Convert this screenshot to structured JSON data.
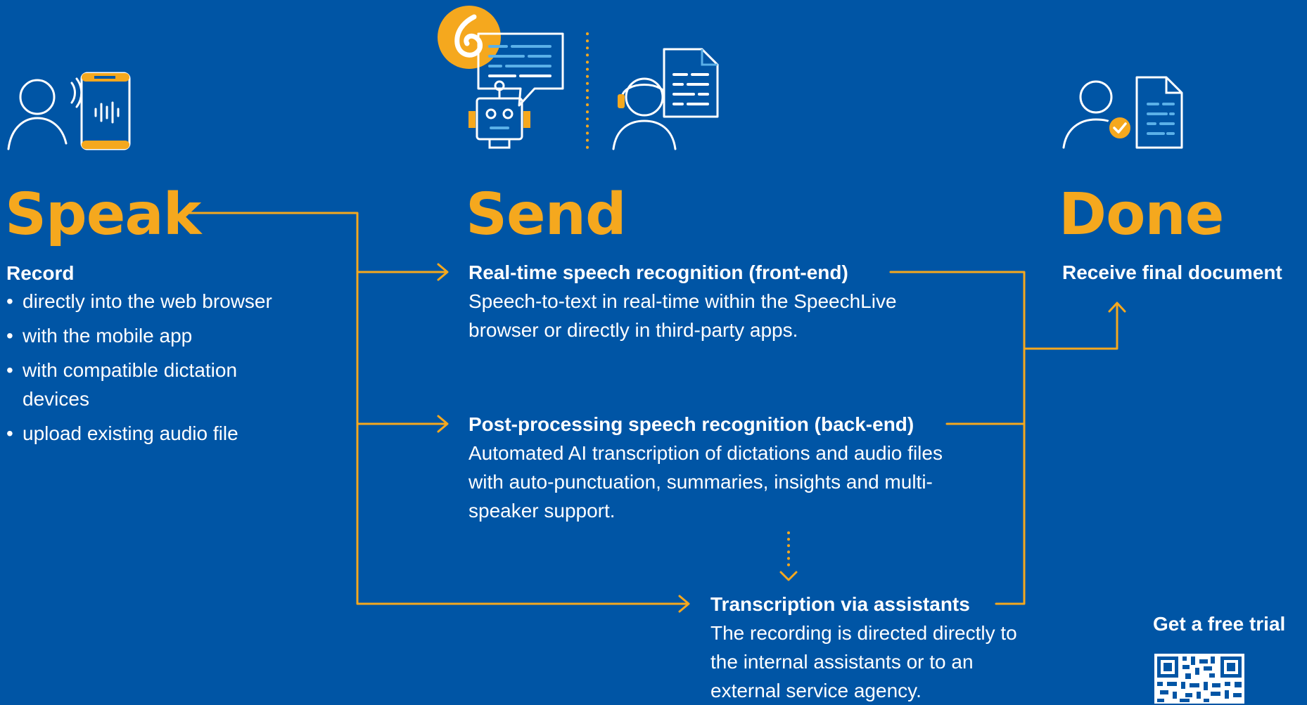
{
  "colors": {
    "background": "#0055a5",
    "accent": "#f5a81e",
    "text": "#ffffff",
    "light_blue": "#5ab0e8"
  },
  "speak": {
    "heading": "Speak",
    "subheading": "Record",
    "items": [
      "directly into the web browser",
      "with the mobile app",
      "with compatible dictation devices",
      "upload existing audio file"
    ]
  },
  "send": {
    "heading": "Send",
    "steps": [
      {
        "title": "Real-time speech recognition (front-end)",
        "body": "Speech-to-text in real-time within the SpeechLive browser or directly in third-party apps."
      },
      {
        "title": "Post-processing speech recognition (back-end)",
        "body": "Automated AI transcription of dictations and audio files with auto-punctuation, summaries, insights and multi-speaker support."
      },
      {
        "title": "Transcription via assistants",
        "body": "The recording is directed directly to the internal assistants or to an external service agency."
      }
    ]
  },
  "done": {
    "heading": "Done",
    "subheading": "Receive final document"
  },
  "trial": {
    "label": "Get a free trial"
  },
  "icons": [
    "person-phone-icon",
    "dragon-logo-icon",
    "chat-bubble-icon",
    "robot-icon",
    "person-headset-icon",
    "document-icon",
    "person-check-icon"
  ]
}
